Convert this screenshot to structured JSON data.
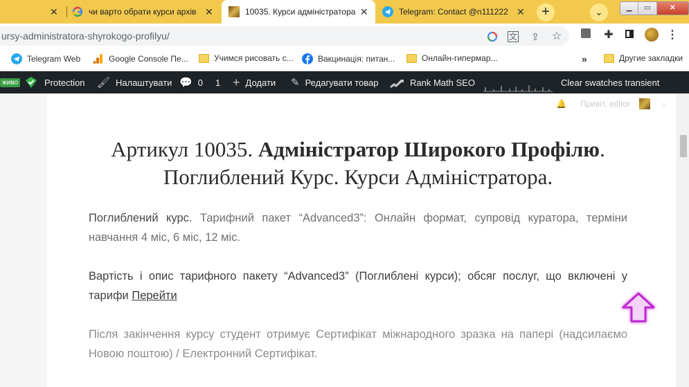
{
  "tabs": [
    {
      "title": "чи варто обрати курси архів",
      "active": false
    },
    {
      "title": "10035. Курси адміністратора",
      "active": true
    },
    {
      "title": "Telegram: Contact @n111222",
      "active": false
    }
  ],
  "address_bar": {
    "url": "ursy-administratora-shyrokogo-profilyu/"
  },
  "bookmarks": [
    {
      "label": "Telegram Web",
      "icon": "telegram-icon"
    },
    {
      "label": "Google Console Пе...",
      "icon": "analytics-icon"
    },
    {
      "label": "Учимся рисовать с...",
      "icon": "folder-icon"
    },
    {
      "label": "Вакцинація: питан...",
      "icon": "facebook-icon"
    },
    {
      "label": "Онлайн-гипермар...",
      "icon": "folder-icon"
    }
  ],
  "bookmarks_overflow": "»",
  "other_bookmarks": "Другие закладки",
  "wp_admin_bar": {
    "badge": "живо",
    "protection": "Protection",
    "customize": "Налаштувати",
    "comments_count": "0",
    "updates_count": "1",
    "add_new": "Додати",
    "edit_product": "Редагувати товар",
    "rank_math": "Rank Math SEO",
    "clear_swatches": "Clear swatches transient"
  },
  "greeting": "Привіт, editor",
  "article": {
    "heading_prefix": "Артикул 10035. ",
    "heading_bold": "Адміністратор Широкого Профілю",
    "heading_suffix": ". Поглиблений Курс. Курси Адміністратора.",
    "p1_bold": "Поглиблений курс.",
    "p1_text": " Тарифний пакет “Advanced3”: Онлайн формат, супровід куратора, терміни навчання 4 міс, 6 міс, 12 міс.",
    "p2_text": "Вартість і опис тарифного пакету “Advanced3” (Поглиблені курси); обсяг послуг, що включені у тарифи ",
    "p2_link": "Перейти",
    "p3_text": "Після закінчення курсу студент отримує Сертифікат міжнародного зразка  на папері (надсилаємо Новою поштою) / Електронний Сертифікат."
  },
  "colors": {
    "tabstrip": "#f2c94c",
    "wp_bar": "#1d2327",
    "arrow": "#c026d3"
  }
}
